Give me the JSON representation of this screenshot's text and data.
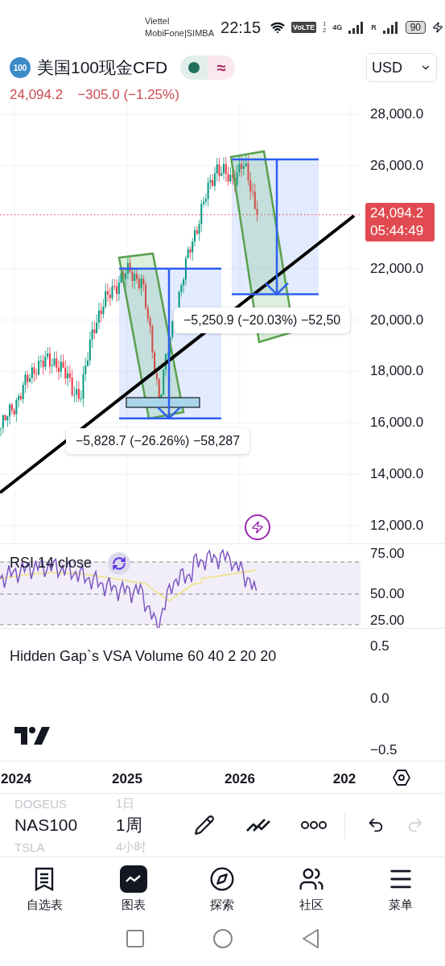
{
  "status_bar": {
    "carriers": [
      "Viettel",
      "MobiFone|SIMBA"
    ],
    "time": "22:15",
    "volte": "VoLTE",
    "sim_slots": [
      "1",
      "2"
    ],
    "network": "4G",
    "roaming": "R",
    "battery": "90"
  },
  "header": {
    "badge": "100",
    "title": "美国100现金CFD",
    "delay_mark": "≈",
    "currency": "USD",
    "price": "24,094.2",
    "change": "−305.0 (−1.25%)"
  },
  "chart": {
    "price_axis": [
      "28,000.0",
      "26,000.0",
      "22,000.0",
      "20,000.0",
      "18,000.0",
      "16,000.0",
      "14,000.0",
      "12,000.0"
    ],
    "last_price": {
      "price": "24,094.2",
      "countdown": "05:44:49"
    },
    "measurements": [
      {
        "text": "−5,250.9 (−20.03%) −52,50"
      },
      {
        "text": "−5,828.7 (−26.26%) −58,287"
      }
    ]
  },
  "rsi": {
    "label": "RSI 14 close",
    "axis": [
      "75.00",
      "50.00",
      "25.00"
    ]
  },
  "volume": {
    "label": "Hidden Gap`s VSA Volume 60 40 2 20 20",
    "axis": [
      "0.5",
      "0.0",
      "−0.5"
    ]
  },
  "time_axis": [
    "2024",
    "2025",
    "2026",
    "202"
  ],
  "picker": [
    {
      "symbol": "DOGEUS",
      "interval": "1日",
      "selected": false
    },
    {
      "symbol": "NAS100",
      "interval": "1周",
      "selected": true
    },
    {
      "symbol": "TSLA",
      "interval": "4小时",
      "selected": false
    }
  ],
  "nav": [
    {
      "label": "自选表",
      "selected": false
    },
    {
      "label": "图表",
      "selected": true
    },
    {
      "label": "探索",
      "selected": false
    },
    {
      "label": "社区",
      "selected": false
    },
    {
      "label": "菜单",
      "selected": false
    }
  ]
}
